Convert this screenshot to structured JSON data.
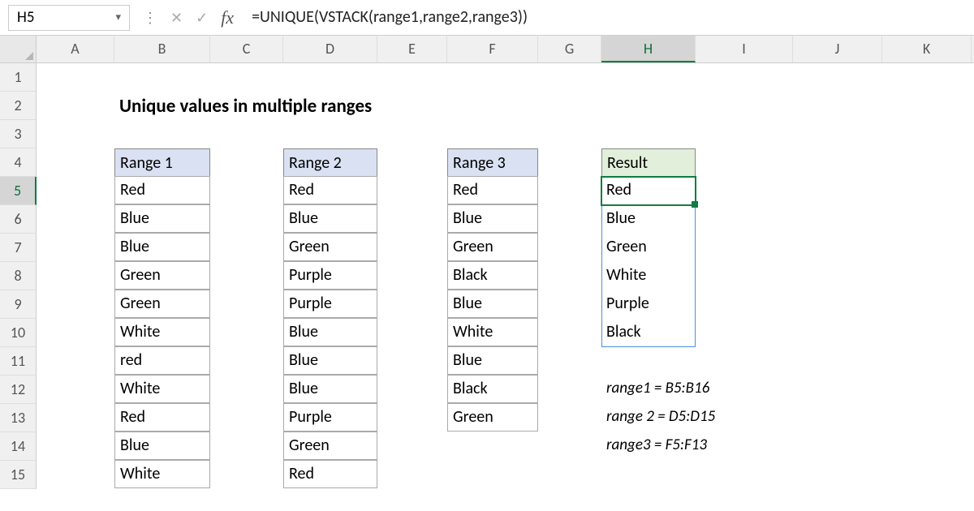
{
  "nameBox": "H5",
  "formula": "=UNIQUE(VSTACK(range1,range2,range3))",
  "columns": [
    "A",
    "B",
    "C",
    "D",
    "E",
    "F",
    "G",
    "H",
    "I",
    "J",
    "K"
  ],
  "activeCol": "H",
  "rows": [
    "1",
    "2",
    "3",
    "4",
    "5",
    "6",
    "7",
    "8",
    "9",
    "10",
    "11",
    "12",
    "13",
    "14",
    "15"
  ],
  "activeRow": "5",
  "title": "Unique values in multiple ranges",
  "headers": {
    "b": "Range 1",
    "d": "Range 2",
    "f": "Range 3",
    "h": "Result"
  },
  "range1": [
    "Red",
    "Blue",
    "Blue",
    "Green",
    "Green",
    "White",
    "red",
    "White",
    "Red",
    "Blue",
    "White"
  ],
  "range2": [
    "Red",
    "Blue",
    "Green",
    "Purple",
    "Purple",
    "Blue",
    "Blue",
    "Blue",
    "Purple",
    "Green",
    "Red"
  ],
  "range3": [
    "Red",
    "Blue",
    "Green",
    "Black",
    "Blue",
    "White",
    "Blue",
    "Black",
    "Green"
  ],
  "result": [
    "Red",
    "Blue",
    "Green",
    "White",
    "Purple",
    "Black"
  ],
  "notes": {
    "n1": "range1 = B5:B16",
    "n2": "range 2 = D5:D15",
    "n3": "range3 = F5:F13"
  }
}
